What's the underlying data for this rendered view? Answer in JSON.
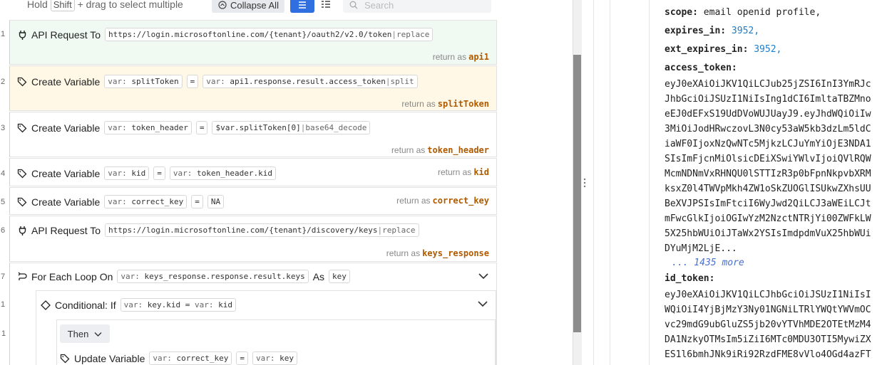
{
  "toolbar": {
    "hint_prefix": "Hold",
    "hint_key": "Shift",
    "hint_suffix": "+ drag to select multiple",
    "collapse_label": "Collapse All",
    "search_placeholder": "Search"
  },
  "steps": [
    {
      "n": "1",
      "title": "API Request To",
      "url": "https://login.microsoftonline.com/{tenant}/oauth2/v2.0/token",
      "filter": "replace",
      "ret_label": "return as",
      "ret": "api1"
    },
    {
      "n": "2",
      "title": "Create Variable",
      "var": "splitToken",
      "op": "=",
      "val_pre": "var:",
      "val": "api1.response.result.access_token",
      "filter": "split",
      "ret_label": "return as",
      "ret": "splitToken"
    },
    {
      "n": "3",
      "title": "Create Variable",
      "var": "token_header",
      "op": "=",
      "val": "$var.splitToken[0]",
      "filter": "base64_decode",
      "ret_label": "return as",
      "ret": "token_header"
    },
    {
      "n": "4",
      "title": "Create Variable",
      "var": "kid",
      "op": "=",
      "val_pre": "var:",
      "val": "token_header.kid",
      "ret_label": "return as",
      "ret": "kid"
    },
    {
      "n": "5",
      "title": "Create Variable",
      "var": "correct_key",
      "op": "=",
      "val": "NA",
      "ret_label": "return as",
      "ret": "correct_key"
    },
    {
      "n": "6",
      "title": "API Request To",
      "url": "https://login.microsoftonline.com/{tenant}/discovery/keys",
      "filter": "replace",
      "ret_label": "return as",
      "ret": "keys_response"
    },
    {
      "n": "7",
      "title": "For Each Loop On",
      "val_pre": "var:",
      "val": "keys_response.response.result.keys",
      "as_label": "As",
      "as_val": "key"
    },
    {
      "n": "1",
      "title": "Conditional: If",
      "val_pre": "var:",
      "val": "key.kid",
      "op": "=",
      "val2_pre": "var:",
      "val2": "kid"
    },
    {
      "n": "1",
      "then_label": "Then",
      "title": "Update Variable",
      "var": "correct_key",
      "op": "=",
      "val_pre": "var:",
      "val": "key"
    }
  ],
  "var_prefix": "var:",
  "json_panel": {
    "scope_key": "scope:",
    "scope_val": "email openid profile,",
    "expires_key": "expires_in:",
    "expires_val": "3952,",
    "ext_key": "ext_expires_in:",
    "ext_val": "3952,",
    "access_key": "access_token:",
    "access_lines": [
      "eyJ0eXAiOiJKV1QiLCJub25jZSI6InI3YmRJc",
      "JhbGciOiJSUzI1NiIsIng1dCI6ImltaTBZMno",
      "eEJ0dEFxS19UdDVoWUJUayJ9.eyJhdWQiOiIw",
      "3MiOiJodHRwczovL3N0cy53aW5kb3dzLm5ldC",
      "iaWF0IjoxNzQwNTc5MjkzLCJuYmYiOjE3NDA1",
      "SIsImFjcnMiOlsicDEiXSwiYWlvIjoiQVlRQW",
      "McmNDNmVxRHNQU0lSTTIzR3p0bFpnNkpvbXRM",
      "ksxZ0l4TWVpMkh4ZW1oSkZUOGlISUkwZXhsUU",
      "BeXVJPSIsImFtciI6WyJwd2QiLCJ3aWEiLCJt",
      "mFwcGlkIjoiOGIwYzM2NzctNTRjYi00ZWFkLW",
      "5X25hbWUiOiJTaWx2YSIsImdpdmVuX25hbWUi",
      "DYuMjM2LjE..."
    ],
    "more_label": "... 1435 more",
    "id_key": "id_token:",
    "id_lines": [
      "eyJ0eXAiOiJKV1QiLCJhbGciOiJSUzI1NiIsI",
      "WQiOiI4YjBjMzY3Ny01NGNiLTRlYWQtYWVmOC",
      "vc29mdG9ubGluZS5jb20vYTVhMDE2OTEtMzM4",
      "DA1NzkyOTMsIm5iZiI6MTc0MDU3OTI5MywiZX",
      "ES1l6bmhJNk9iRi92RzdFME8vVlo4OGd4azFT"
    ]
  }
}
